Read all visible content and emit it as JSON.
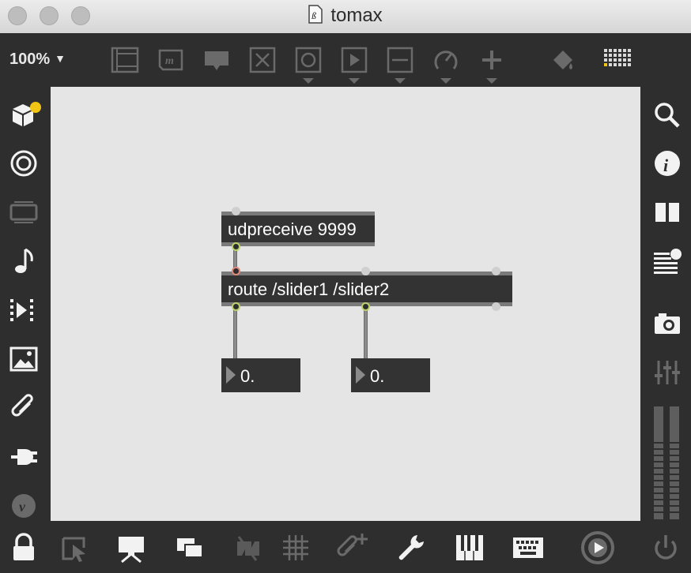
{
  "window": {
    "title": "tomax"
  },
  "toolbar": {
    "zoom_label": "100%",
    "zoom_caret": "▼",
    "buttons": [
      {
        "icon": "presentation-frame-icon"
      },
      {
        "icon": "message-box-icon"
      },
      {
        "icon": "comment-icon"
      },
      {
        "icon": "toggle-x-icon"
      },
      {
        "icon": "button-circle-icon"
      },
      {
        "icon": "playbar-icon"
      },
      {
        "icon": "slider-icon"
      },
      {
        "icon": "dial-icon"
      },
      {
        "icon": "add-object-icon"
      },
      {
        "icon": "paint-bucket-icon"
      },
      {
        "icon": "grid-keyboard-icon"
      }
    ]
  },
  "patcher": {
    "objects": [
      {
        "name": "udpreceive-object",
        "text": "udpreceive 9999"
      },
      {
        "name": "route-object",
        "text": "route /slider1 /slider2"
      }
    ],
    "number_boxes": [
      {
        "name": "float-number-1",
        "value": "0."
      },
      {
        "name": "float-number-2",
        "value": "0."
      }
    ]
  },
  "left_sidebar": [
    "cube-package-icon",
    "target-icon",
    "display-icon",
    "music-note-icon",
    "media-playlist-icon",
    "image-icon",
    "paperclip-icon",
    "plug-icon",
    "vimeo-icon"
  ],
  "right_sidebar": [
    "search-icon",
    "info-icon",
    "split-view-icon",
    "list-icon",
    "camera-icon",
    "mixer-icon",
    "level-meter-icon"
  ],
  "bottom_bar": [
    "lock-icon",
    "select-icon",
    "presentation-icon",
    "layers-icon",
    "hide-icon",
    "grid-icon",
    "new-attachment-icon",
    "wrench-icon",
    "piano-icon",
    "keyboard-icon",
    "transport-play-icon",
    "power-icon"
  ],
  "colors": {
    "background": "#2e2e2e",
    "canvas": "#e5e5e5",
    "object": "#333333",
    "accent": "#f2c415"
  }
}
